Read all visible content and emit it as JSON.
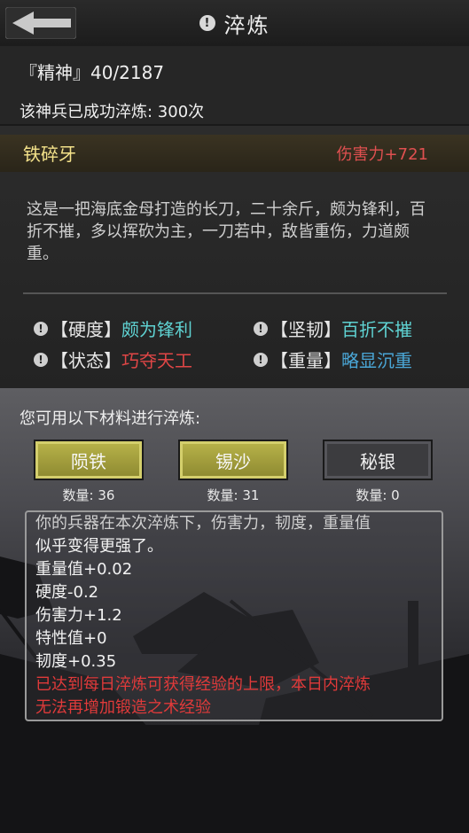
{
  "header": {
    "title": "淬炼",
    "back_icon": "back-arrow-icon",
    "warn_icon": "!"
  },
  "info": {
    "spirit": "『精神』40/2187",
    "success_count": "该神兵已成功淬炼: 300次"
  },
  "weapon": {
    "name": "铁碎牙",
    "damage": "伤害力+721",
    "description": "这是一把海底金母打造的长刀，二十余斤，颇为锋利，百折不摧，多以挥砍为主，一刀若中，敌皆重伤，力道颇重。",
    "attributes": [
      {
        "label": "【硬度】",
        "value": "颇为锋利",
        "color": "#5fd2d2"
      },
      {
        "label": "【坚韧】",
        "value": "百折不摧",
        "color": "#5fd2d2"
      },
      {
        "label": "【状态】",
        "value": "巧夺天工",
        "color": "#e04646"
      },
      {
        "label": "【重量】",
        "value": "略显沉重",
        "color": "#4aa6d6"
      }
    ]
  },
  "materials": {
    "title": "您可用以下材料进行淬炼:",
    "items": [
      {
        "name": "陨铁",
        "count": "数量: 36"
      },
      {
        "name": "锡沙",
        "count": "数量: 31"
      },
      {
        "name": "秘银",
        "count": "数量: 0"
      }
    ]
  },
  "log": {
    "partial_line": "你的兵器在本次淬炼下，伤害力，韧度，重量值",
    "lines": [
      "似乎变得更强了。",
      "重量值+0.02",
      "硬度-0.2",
      "伤害力+1.2",
      "特性值+0",
      "韧度+0.35"
    ],
    "warning_lines": [
      "已达到每日淬炼可获得经验的上限，本日内淬炼",
      "无法再增加锻造之术经验"
    ]
  }
}
